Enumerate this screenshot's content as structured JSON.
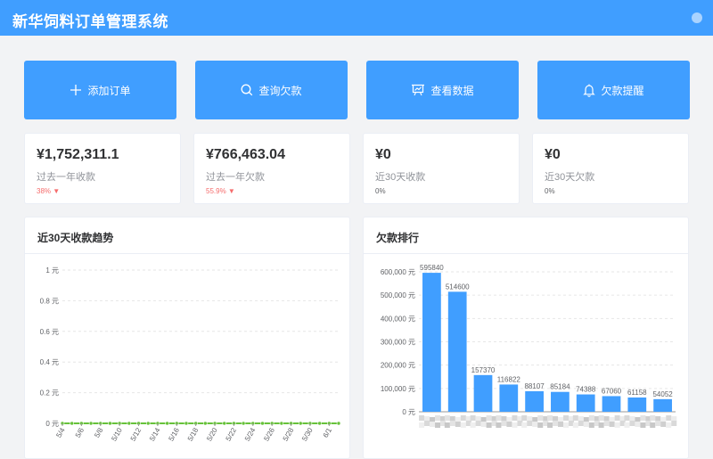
{
  "header": {
    "title": "新华饲料订单管理系统"
  },
  "colors": {
    "primary": "#409eff",
    "line": "#67c23a",
    "down": "#f56c6c"
  },
  "actions": [
    {
      "label": "添加订单",
      "icon": "plus-icon"
    },
    {
      "label": "查询欠款",
      "icon": "search-icon"
    },
    {
      "label": "查看数据",
      "icon": "chart-board-icon"
    },
    {
      "label": "欠款提醒",
      "icon": "bell-icon"
    }
  ],
  "stats": [
    {
      "value": "¥1,752,311.1",
      "label": "过去一年收款",
      "change": "38%",
      "trend": "down"
    },
    {
      "value": "¥766,463.04",
      "label": "过去一年欠款",
      "change": "55.9%",
      "trend": "down"
    },
    {
      "value": "¥0",
      "label": "近30天收款",
      "change": "0%"
    },
    {
      "value": "¥0",
      "label": "近30天欠款",
      "change": "0%"
    }
  ],
  "panels": {
    "trend_title": "近30天收款趋势",
    "ranking_title": "欠款排行"
  },
  "chart_data": [
    {
      "type": "line",
      "title": "近30天收款趋势",
      "x": [
        "5/4",
        "5/5",
        "5/6",
        "5/7",
        "5/8",
        "5/9",
        "5/10",
        "5/11",
        "5/12",
        "5/13",
        "5/14",
        "5/15",
        "5/16",
        "5/17",
        "5/18",
        "5/19",
        "5/20",
        "5/21",
        "5/22",
        "5/23",
        "5/24",
        "5/25",
        "5/26",
        "5/27",
        "5/28",
        "5/29",
        "5/30",
        "5/31",
        "6/1",
        "6/2"
      ],
      "x_tick_labels": [
        "5/4",
        "5/6",
        "5/8",
        "5/10",
        "5/12",
        "5/14",
        "5/16",
        "5/18",
        "5/20",
        "5/22",
        "5/24",
        "5/26",
        "5/28",
        "5/30",
        "6/1"
      ],
      "values": [
        0,
        0,
        0,
        0,
        0,
        0,
        0,
        0,
        0,
        0,
        0,
        0,
        0,
        0,
        0,
        0,
        0,
        0,
        0,
        0,
        0,
        0,
        0,
        0,
        0,
        0,
        0,
        0,
        0,
        0
      ],
      "y_ticks": [
        "0 元",
        "0.2 元",
        "0.4 元",
        "0.6 元",
        "0.8 元",
        "1 元"
      ],
      "ylim": [
        0,
        1
      ],
      "grid": true
    },
    {
      "type": "bar",
      "title": "欠款排行",
      "values": [
        595840,
        514600,
        157370,
        116822,
        88107,
        85184,
        74388,
        67060,
        61158,
        54052
      ],
      "y_ticks": [
        "0 元",
        "100,000 元",
        "200,000 元",
        "300,000 元",
        "400,000 元",
        "500,000 元",
        "600,000 元"
      ],
      "ylim": [
        0,
        600000
      ],
      "grid": true
    }
  ]
}
